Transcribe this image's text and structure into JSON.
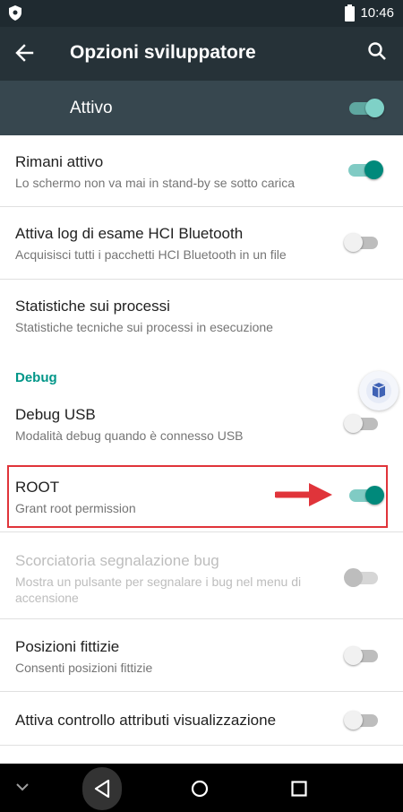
{
  "status_bar": {
    "time": "10:46"
  },
  "app_bar": {
    "title": "Opzioni sviluppatore"
  },
  "master_toggle": {
    "label": "Attivo",
    "state": "on"
  },
  "settings": [
    {
      "title": "Rimani attivo",
      "subtitle": "Lo schermo non va mai in stand-by se sotto carica",
      "toggle": "on"
    },
    {
      "title": "Attiva log di esame HCI Bluetooth",
      "subtitle": "Acquisisci tutti i pacchetti HCI Bluetooth in un file",
      "toggle": "off"
    },
    {
      "title": "Statistiche sui processi",
      "subtitle": "Statistiche tecniche sui processi in esecuzione"
    }
  ],
  "section_debug": "Debug",
  "debug_settings": [
    {
      "title": "Debug USB",
      "subtitle": "Modalità debug quando è connesso USB",
      "toggle": "off"
    },
    {
      "title": "ROOT",
      "subtitle": "Grant root permission",
      "toggle": "on"
    },
    {
      "title": "Scorciatoria segnalazione bug",
      "subtitle": "Mostra un pulsante per segnalare i bug nel menu di accensione",
      "toggle": "off",
      "disabled": true
    },
    {
      "title": "Posizioni fittizie",
      "subtitle": "Consenti posizioni fittizie",
      "toggle": "off"
    },
    {
      "title": "Attiva controllo attributi visualizzazione",
      "toggle": "off"
    }
  ],
  "colors": {
    "accent": "#009688",
    "app_bar": "#263238",
    "annotation": "#e0343a"
  }
}
